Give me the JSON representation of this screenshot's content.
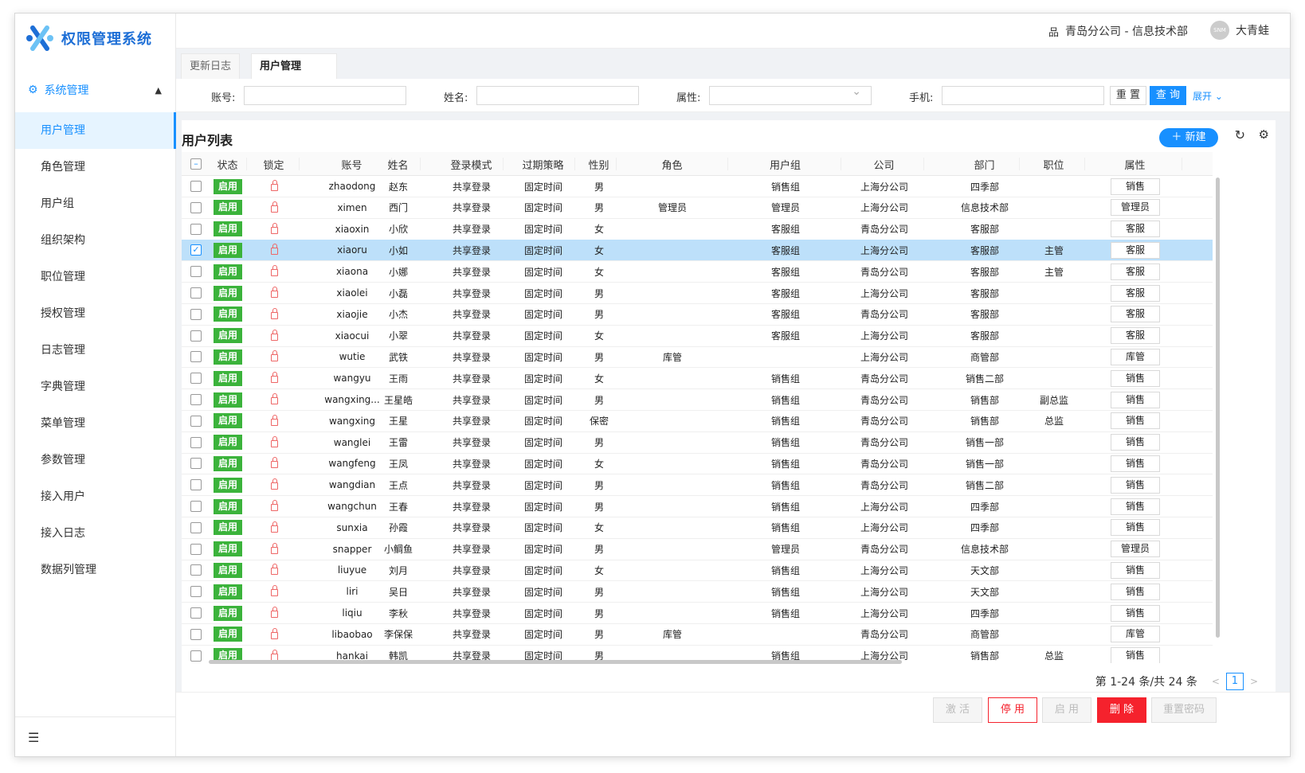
{
  "app": {
    "title": "权限管理系统"
  },
  "sidebar": {
    "group_label": "系统管理",
    "items": [
      {
        "label": "用户管理",
        "active": true
      },
      {
        "label": "角色管理"
      },
      {
        "label": "用户组"
      },
      {
        "label": "组织架构"
      },
      {
        "label": "职位管理"
      },
      {
        "label": "授权管理"
      },
      {
        "label": "日志管理"
      },
      {
        "label": "字典管理"
      },
      {
        "label": "菜单管理"
      },
      {
        "label": "参数管理"
      },
      {
        "label": "接入用户"
      },
      {
        "label": "接入日志"
      },
      {
        "label": "数据列管理"
      }
    ]
  },
  "header": {
    "org": "青岛分公司 - 信息技术部",
    "avatar_text": "SNM",
    "user_name": "大青蛙"
  },
  "tabs": [
    {
      "label": "更新日志"
    },
    {
      "label": "用户管理",
      "active": true,
      "close": "×"
    }
  ],
  "search": {
    "account_label": "账号:",
    "name_label": "姓名:",
    "attr_label": "属性:",
    "phone_label": "手机:",
    "reset_label": "重 置",
    "query_label": "查 询",
    "expand_label": "展开"
  },
  "panel": {
    "title": "用户列表",
    "new_label": "新建"
  },
  "table": {
    "columns": [
      "状态",
      "锁定",
      "账号",
      "姓名",
      "登录模式",
      "过期策略",
      "性别",
      "角色",
      "用户组",
      "公司",
      "部门",
      "职位",
      "属性"
    ],
    "rows": [
      {
        "status": "启用",
        "account": "zhaodong",
        "name": "赵东",
        "mode": "共享登录",
        "policy": "固定时间",
        "gender": "男",
        "role": "",
        "group": "销售组",
        "company": "上海分公司",
        "dept": "四季部",
        "position": "",
        "attr": "销售"
      },
      {
        "status": "启用",
        "account": "ximen",
        "name": "西门",
        "mode": "共享登录",
        "policy": "固定时间",
        "gender": "男",
        "role": "管理员",
        "group": "管理员",
        "company": "上海分公司",
        "dept": "信息技术部",
        "position": "",
        "attr": "管理员"
      },
      {
        "status": "启用",
        "account": "xiaoxin",
        "name": "小欣",
        "mode": "共享登录",
        "policy": "固定时间",
        "gender": "女",
        "role": "",
        "group": "客服组",
        "company": "青岛分公司",
        "dept": "客服部",
        "position": "",
        "attr": "客服"
      },
      {
        "status": "启用",
        "account": "xiaoru",
        "name": "小如",
        "mode": "共享登录",
        "policy": "固定时间",
        "gender": "女",
        "role": "",
        "group": "客服组",
        "company": "上海分公司",
        "dept": "客服部",
        "position": "主管",
        "attr": "客服",
        "selected": true
      },
      {
        "status": "启用",
        "account": "xiaona",
        "name": "小娜",
        "mode": "共享登录",
        "policy": "固定时间",
        "gender": "女",
        "role": "",
        "group": "客服组",
        "company": "青岛分公司",
        "dept": "客服部",
        "position": "主管",
        "attr": "客服"
      },
      {
        "status": "启用",
        "account": "xiaolei",
        "name": "小磊",
        "mode": "共享登录",
        "policy": "固定时间",
        "gender": "男",
        "role": "",
        "group": "客服组",
        "company": "上海分公司",
        "dept": "客服部",
        "position": "",
        "attr": "客服"
      },
      {
        "status": "启用",
        "account": "xiaojie",
        "name": "小杰",
        "mode": "共享登录",
        "policy": "固定时间",
        "gender": "男",
        "role": "",
        "group": "客服组",
        "company": "青岛分公司",
        "dept": "客服部",
        "position": "",
        "attr": "客服"
      },
      {
        "status": "启用",
        "account": "xiaocui",
        "name": "小翠",
        "mode": "共享登录",
        "policy": "固定时间",
        "gender": "女",
        "role": "",
        "group": "客服组",
        "company": "上海分公司",
        "dept": "客服部",
        "position": "",
        "attr": "客服"
      },
      {
        "status": "启用",
        "account": "wutie",
        "name": "武铁",
        "mode": "共享登录",
        "policy": "固定时间",
        "gender": "男",
        "role": "库管",
        "group": "",
        "company": "上海分公司",
        "dept": "商管部",
        "position": "",
        "attr": "库管"
      },
      {
        "status": "启用",
        "account": "wangyu",
        "name": "王雨",
        "mode": "共享登录",
        "policy": "固定时间",
        "gender": "女",
        "role": "",
        "group": "销售组",
        "company": "青岛分公司",
        "dept": "销售二部",
        "position": "",
        "attr": "销售"
      },
      {
        "status": "启用",
        "account": "wangxing...",
        "name": "王星皓",
        "mode": "共享登录",
        "policy": "固定时间",
        "gender": "男",
        "role": "",
        "group": "销售组",
        "company": "青岛分公司",
        "dept": "销售部",
        "position": "副总监",
        "attr": "销售"
      },
      {
        "status": "启用",
        "account": "wangxing",
        "name": "王星",
        "mode": "共享登录",
        "policy": "固定时间",
        "gender": "保密",
        "role": "",
        "group": "销售组",
        "company": "青岛分公司",
        "dept": "销售部",
        "position": "总监",
        "attr": "销售"
      },
      {
        "status": "启用",
        "account": "wanglei",
        "name": "王雷",
        "mode": "共享登录",
        "policy": "固定时间",
        "gender": "男",
        "role": "",
        "group": "销售组",
        "company": "青岛分公司",
        "dept": "销售一部",
        "position": "",
        "attr": "销售"
      },
      {
        "status": "启用",
        "account": "wangfeng",
        "name": "王凤",
        "mode": "共享登录",
        "policy": "固定时间",
        "gender": "女",
        "role": "",
        "group": "销售组",
        "company": "青岛分公司",
        "dept": "销售一部",
        "position": "",
        "attr": "销售"
      },
      {
        "status": "启用",
        "account": "wangdian",
        "name": "王点",
        "mode": "共享登录",
        "policy": "固定时间",
        "gender": "男",
        "role": "",
        "group": "销售组",
        "company": "青岛分公司",
        "dept": "销售二部",
        "position": "",
        "attr": "销售"
      },
      {
        "status": "启用",
        "account": "wangchun",
        "name": "王春",
        "mode": "共享登录",
        "policy": "固定时间",
        "gender": "男",
        "role": "",
        "group": "销售组",
        "company": "上海分公司",
        "dept": "四季部",
        "position": "",
        "attr": "销售"
      },
      {
        "status": "启用",
        "account": "sunxia",
        "name": "孙霞",
        "mode": "共享登录",
        "policy": "固定时间",
        "gender": "女",
        "role": "",
        "group": "销售组",
        "company": "上海分公司",
        "dept": "四季部",
        "position": "",
        "attr": "销售"
      },
      {
        "status": "启用",
        "account": "snapper",
        "name": "小鲷鱼",
        "mode": "共享登录",
        "policy": "固定时间",
        "gender": "男",
        "role": "",
        "group": "管理员",
        "company": "青岛分公司",
        "dept": "信息技术部",
        "position": "",
        "attr": "管理员"
      },
      {
        "status": "启用",
        "account": "liuyue",
        "name": "刘月",
        "mode": "共享登录",
        "policy": "固定时间",
        "gender": "女",
        "role": "",
        "group": "销售组",
        "company": "上海分公司",
        "dept": "天文部",
        "position": "",
        "attr": "销售"
      },
      {
        "status": "启用",
        "account": "liri",
        "name": "吴日",
        "mode": "共享登录",
        "policy": "固定时间",
        "gender": "男",
        "role": "",
        "group": "销售组",
        "company": "上海分公司",
        "dept": "天文部",
        "position": "",
        "attr": "销售"
      },
      {
        "status": "启用",
        "account": "liqiu",
        "name": "李秋",
        "mode": "共享登录",
        "policy": "固定时间",
        "gender": "男",
        "role": "",
        "group": "销售组",
        "company": "上海分公司",
        "dept": "四季部",
        "position": "",
        "attr": "销售"
      },
      {
        "status": "启用",
        "account": "libaobao",
        "name": "李保保",
        "mode": "共享登录",
        "policy": "固定时间",
        "gender": "男",
        "role": "库管",
        "group": "",
        "company": "青岛分公司",
        "dept": "商管部",
        "position": "",
        "attr": "库管"
      },
      {
        "status": "启用",
        "account": "hankai",
        "name": "韩凯",
        "mode": "共享登录",
        "policy": "固定时间",
        "gender": "男",
        "role": "",
        "group": "销售组",
        "company": "上海分公司",
        "dept": "销售部",
        "position": "总监",
        "attr": "销售"
      }
    ]
  },
  "pager": {
    "summary": "第 1-24 条/共 24 条",
    "prev": "<",
    "page": "1",
    "next": ">"
  },
  "footer": {
    "activate": "激 活",
    "disable": "停 用",
    "enable": "启 用",
    "delete": "删 除",
    "reset_pwd": "重置密码"
  },
  "colors": {
    "accent": "#1890ff",
    "status_green": "#3bb33b",
    "danger": "#f5222d",
    "selected_row": "#bde0fa"
  }
}
